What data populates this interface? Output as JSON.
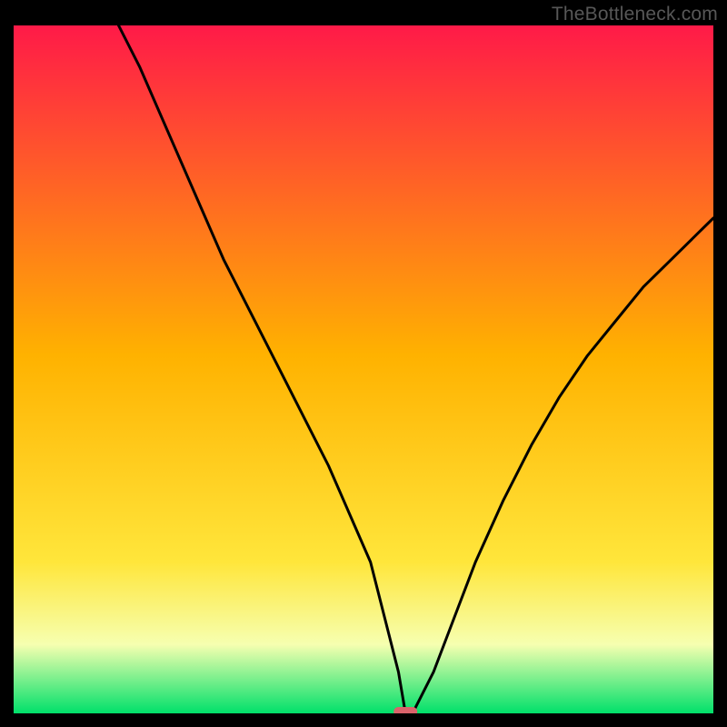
{
  "attribution": "TheBottleneck.com",
  "chart_data": {
    "type": "line",
    "title": "",
    "xlabel": "",
    "ylabel": "",
    "xlim": [
      0,
      100
    ],
    "ylim": [
      0,
      100
    ],
    "background_gradient_top": "#ff1a48",
    "background_gradient_mid": "#ffc200",
    "background_gradient_bottom": "#00e06a",
    "curve_color": "#000000",
    "marker": {
      "x": 56,
      "y": 0,
      "color": "#d9636b",
      "shape": "pill"
    },
    "x": [
      15,
      18,
      21,
      24,
      27,
      30,
      33,
      36,
      39,
      42,
      45,
      48,
      51,
      53,
      55,
      56,
      57,
      58,
      60,
      63,
      66,
      70,
      74,
      78,
      82,
      86,
      90,
      94,
      98,
      100
    ],
    "values": [
      100,
      94,
      87,
      80,
      73,
      66,
      60,
      54,
      48,
      42,
      36,
      29,
      22,
      14,
      6,
      0,
      0,
      2,
      6,
      14,
      22,
      31,
      39,
      46,
      52,
      57,
      62,
      66,
      70,
      72
    ]
  }
}
